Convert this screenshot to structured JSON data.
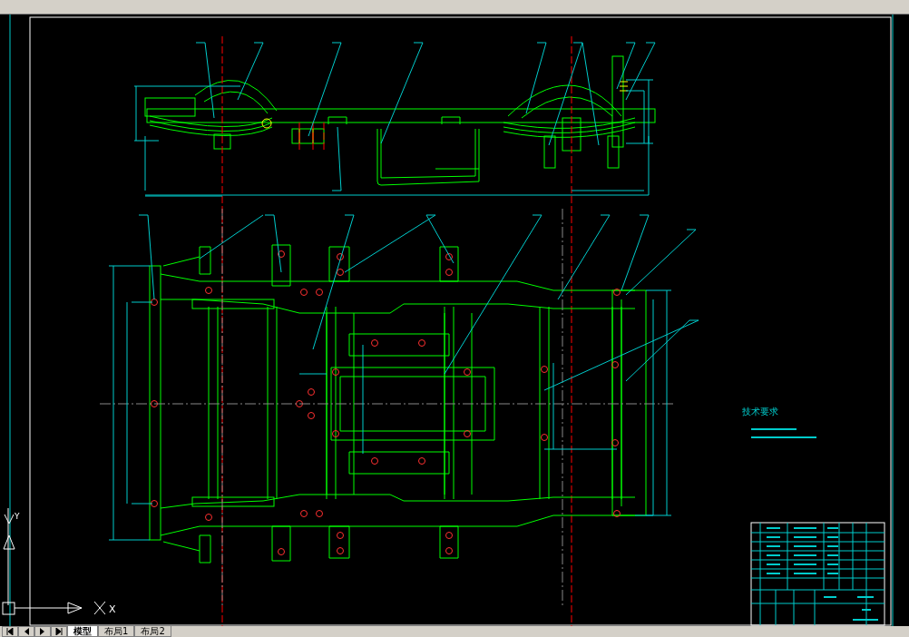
{
  "drawing": {
    "notes_title": "技术要求"
  },
  "ucs_icon": {
    "x_label": "X",
    "y_label": "Y"
  },
  "layout_tabs": [
    {
      "label": "模型",
      "selected": true
    },
    {
      "label": "布局1",
      "selected": false
    },
    {
      "label": "布局2",
      "selected": false
    }
  ]
}
